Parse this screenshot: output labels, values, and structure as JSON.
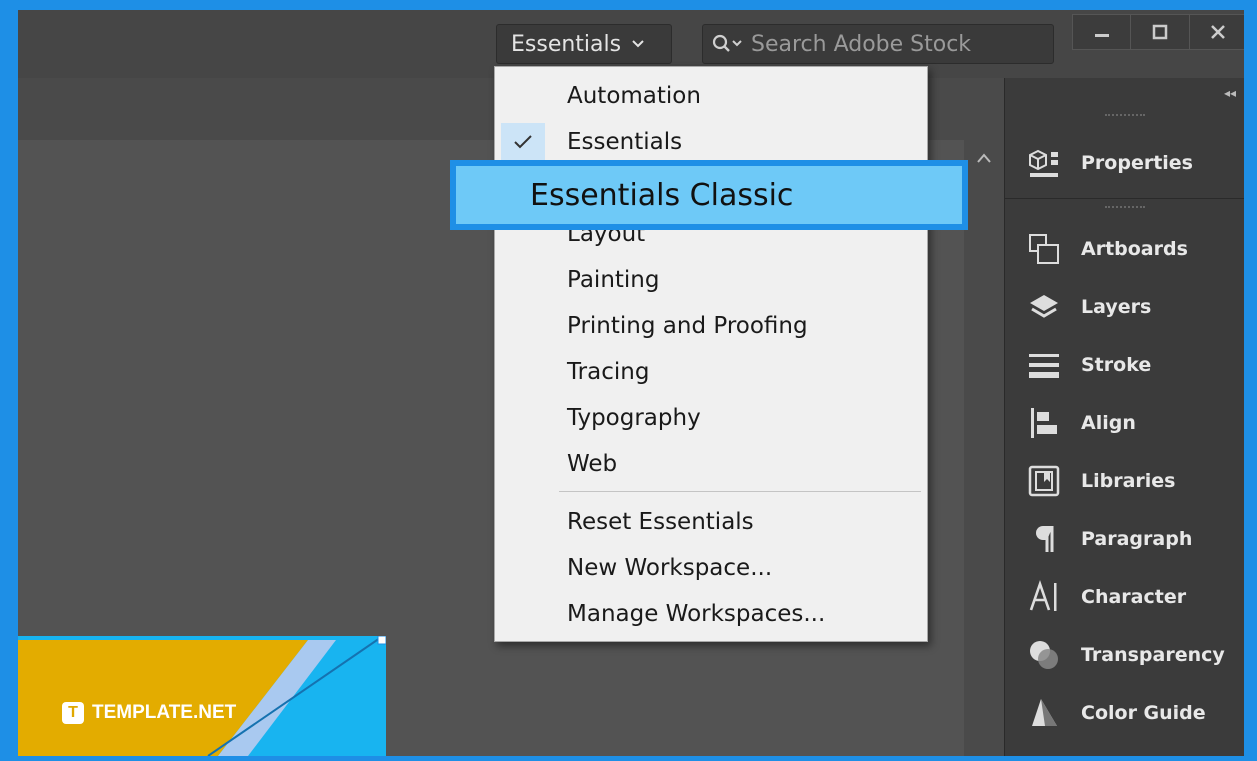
{
  "topbar": {
    "workspace_label": "Essentials",
    "search_placeholder": "Search Adobe Stock"
  },
  "dropdown": {
    "items": [
      {
        "label": "Automation",
        "checked": false
      },
      {
        "label": "Essentials",
        "checked": true
      },
      {
        "label": "Layout",
        "checked": false
      },
      {
        "label": "Painting",
        "checked": false
      },
      {
        "label": "Printing and Proofing",
        "checked": false
      },
      {
        "label": "Tracing",
        "checked": false
      },
      {
        "label": "Typography",
        "checked": false
      },
      {
        "label": "Web",
        "checked": false
      }
    ],
    "actions": [
      {
        "label": "Reset Essentials"
      },
      {
        "label": "New Workspace..."
      },
      {
        "label": "Manage Workspaces..."
      }
    ],
    "highlighted_label": "Essentials Classic"
  },
  "panel": {
    "items": [
      {
        "label": "Properties",
        "icon": "properties-icon"
      },
      {
        "label": "Artboards",
        "icon": "artboards-icon"
      },
      {
        "label": "Layers",
        "icon": "layers-icon"
      },
      {
        "label": "Stroke",
        "icon": "stroke-icon"
      },
      {
        "label": "Align",
        "icon": "align-icon"
      },
      {
        "label": "Libraries",
        "icon": "libraries-icon"
      },
      {
        "label": "Paragraph",
        "icon": "paragraph-icon"
      },
      {
        "label": "Character",
        "icon": "character-icon"
      },
      {
        "label": "Transparency",
        "icon": "transparency-icon"
      },
      {
        "label": "Color Guide",
        "icon": "color-guide-icon"
      }
    ]
  },
  "watermark": {
    "brand": "TEMPLATE.NET"
  },
  "colors": {
    "frame": "#1e8fe6",
    "highlight": "#6ec9f7",
    "menu_bg": "#f0f0f0",
    "panel_bg": "#3b3b3b",
    "canvas_bg": "#535353",
    "thumb_yellow": "#e3ac00",
    "thumb_blue": "#18b4f0"
  }
}
